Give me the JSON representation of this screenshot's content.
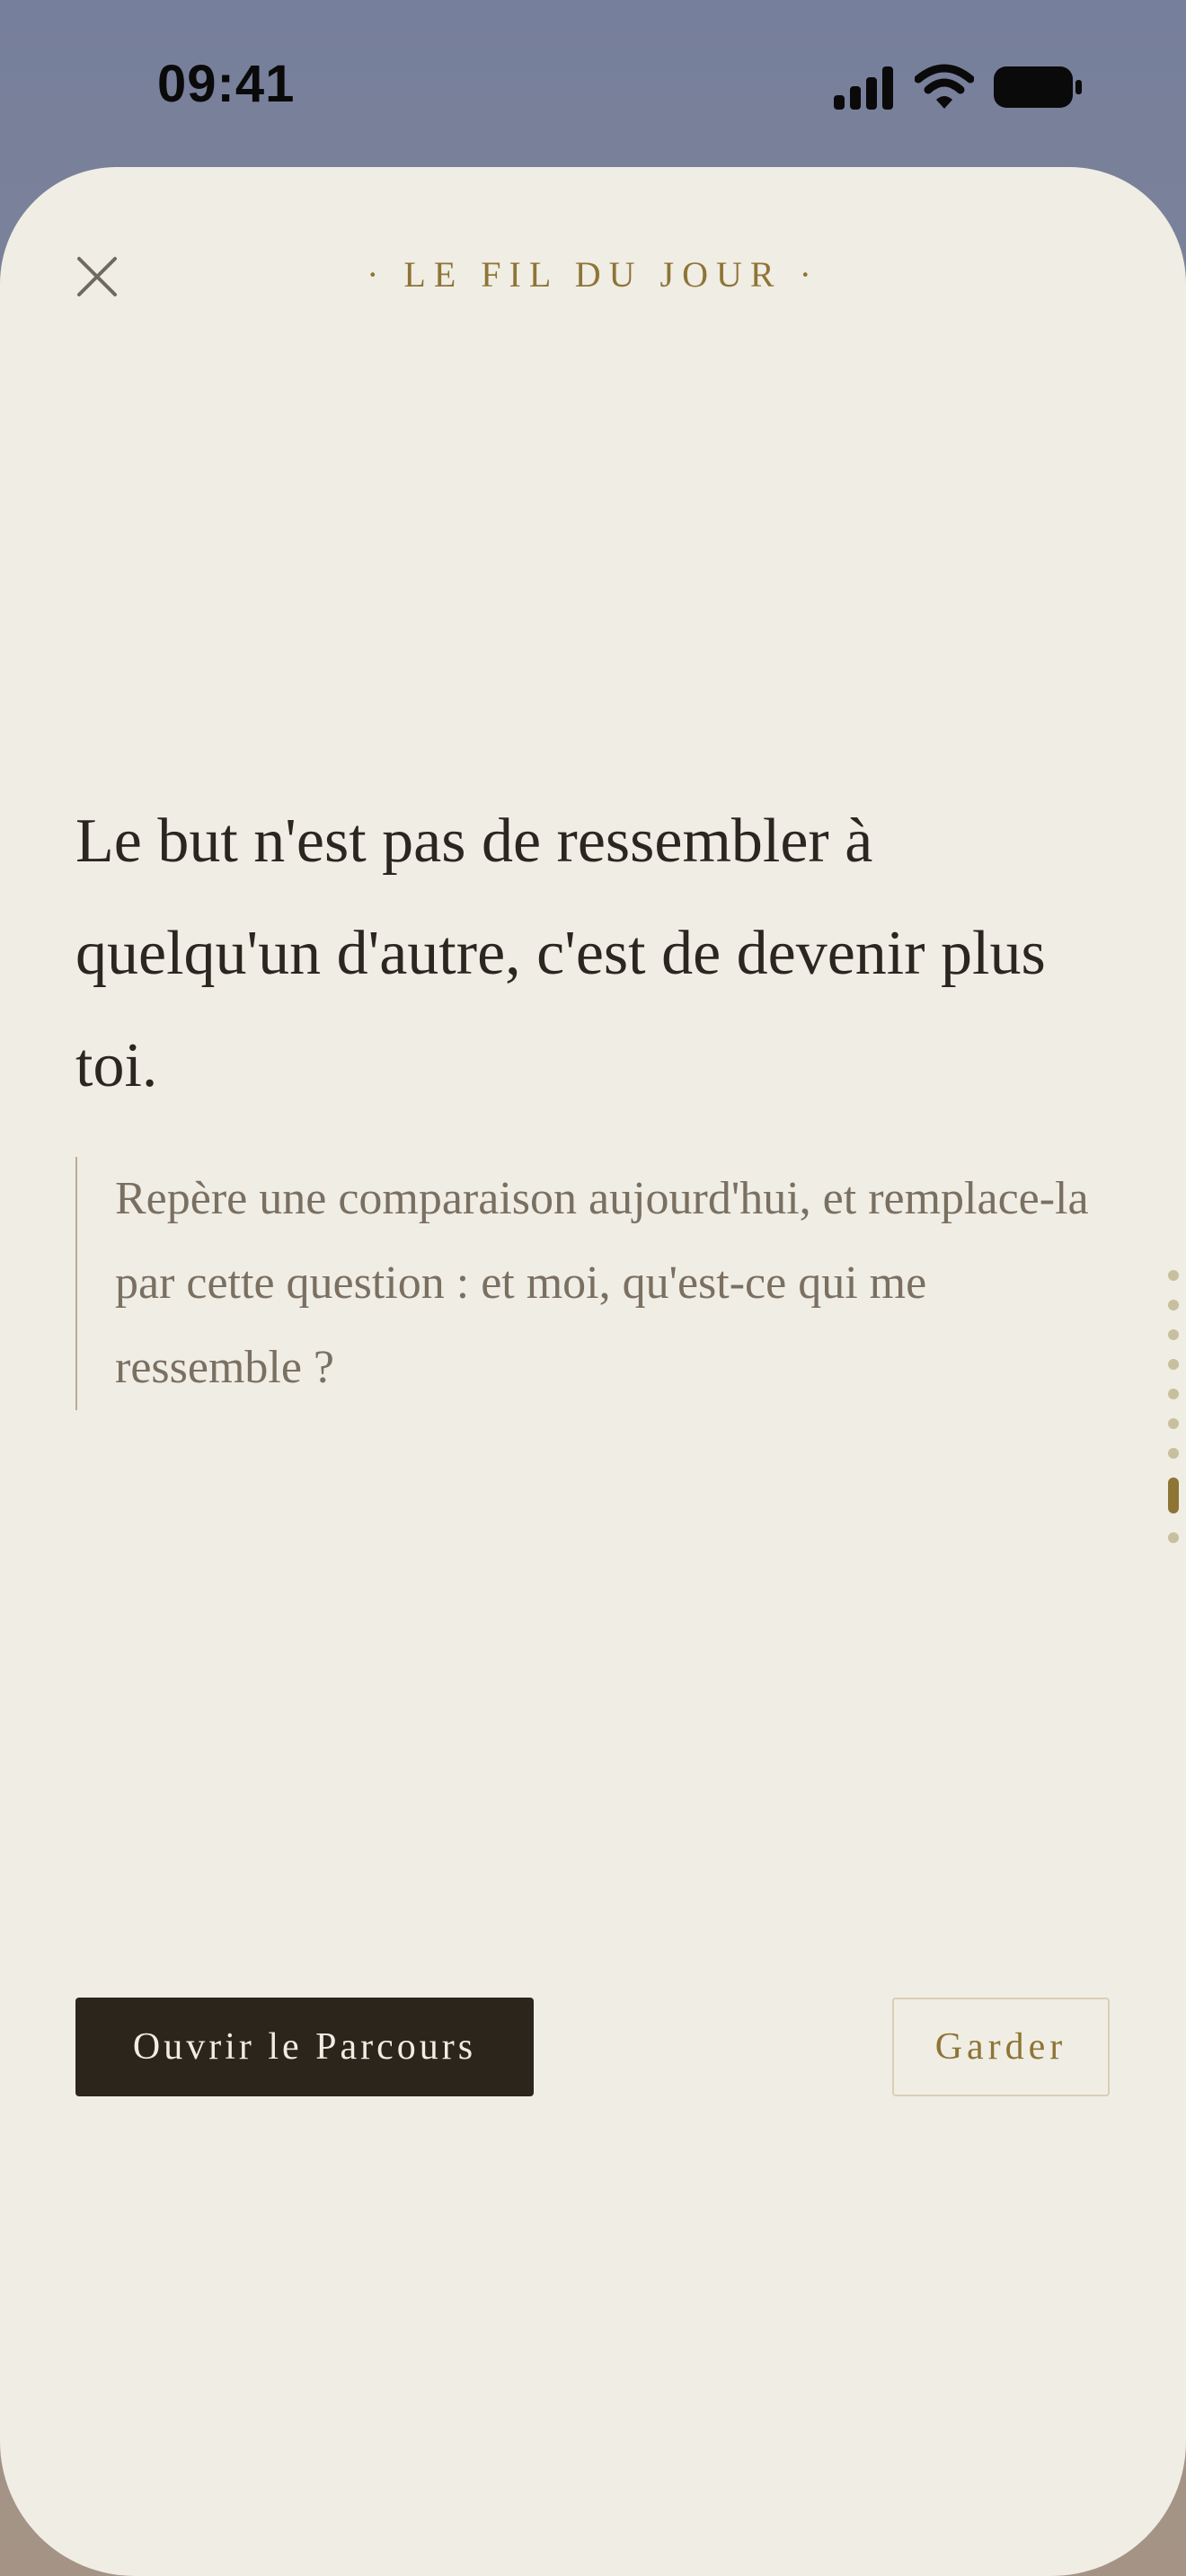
{
  "status_bar": {
    "time": "09:41",
    "icons": [
      "signal-icon",
      "wifi-icon",
      "battery-icon"
    ]
  },
  "sheet": {
    "title": "· LE FIL DU JOUR ·",
    "close_icon": "close-icon",
    "quote": "Le but n'est pas de ressembler à quelqu'un d'autre, c'est de devenir plus toi.",
    "reflection": "Repère une comparaison aujourd'hui, et remplace-la par cette question : et moi, qu'est-ce qui me ressemble ?",
    "pagination": {
      "total": 9,
      "current": 8
    },
    "actions": {
      "primary_label": "Ouvrir le Parcours",
      "secondary_label": "Garder"
    }
  },
  "colors": {
    "accent": "#8e7536",
    "sheet_background": "#f0ede4",
    "primary_button": "#2c251c",
    "text": "#2c2620",
    "muted_text": "#7a7062"
  }
}
